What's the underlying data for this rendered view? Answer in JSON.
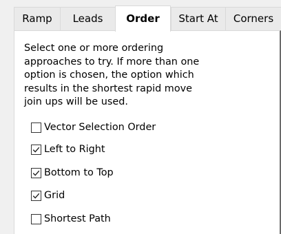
{
  "tabs": [
    {
      "label": "Ramp",
      "selected": false
    },
    {
      "label": "Leads",
      "selected": false
    },
    {
      "label": "Order",
      "selected": true
    },
    {
      "label": "Start At",
      "selected": false
    },
    {
      "label": "Corners",
      "selected": false
    }
  ],
  "description": {
    "lines": [
      "Select one or more ordering",
      "approaches to try. If more than one",
      "option is chosen, the option which",
      "results in the shortest rapid move",
      "join ups will be used."
    ]
  },
  "options": [
    {
      "label": "Vector Selection Order",
      "checked": false
    },
    {
      "label": "Left to Right",
      "checked": true
    },
    {
      "label": "Bottom to Top",
      "checked": true
    },
    {
      "label": "Grid",
      "checked": true
    },
    {
      "label": "Shortest Path",
      "checked": false
    }
  ]
}
